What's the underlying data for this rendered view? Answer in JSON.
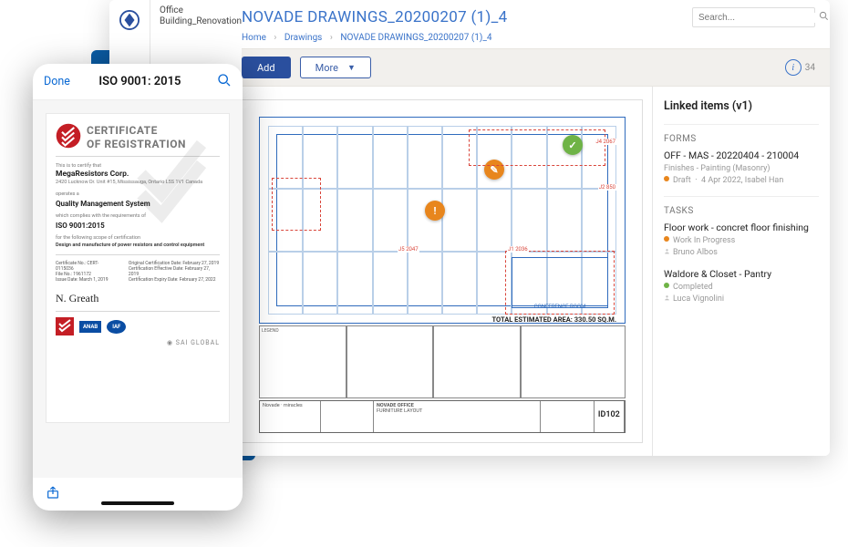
{
  "context_project": "Office Building_Renovation",
  "page_title": "NOVADE DRAWINGS_20200207 (1)_4",
  "search": {
    "placeholder": "Search..."
  },
  "breadcrumbs": {
    "home": "Home",
    "drawings": "Drawings",
    "current": "NOVADE DRAWINGS_20200207 (1)_4"
  },
  "toolbar": {
    "add": "Add",
    "more": "More",
    "info_count": "34"
  },
  "drawing": {
    "area_text": "TOTAL ESTIMATED AREA: 330.50 SQ.M.",
    "conf_room": "CONFERENCE ROOM",
    "sheet_id": "ID102",
    "owner": "NOVADE OFFICE",
    "brand": "Novade",
    "firm": "miracles",
    "schedule_title": "FURNITURE LAYOUT",
    "dim_j5": "J5",
    "dim_j5_val": "2047",
    "dim_j1": "J1",
    "dim_j1_val": "2036",
    "dim_j2": "J2",
    "dim_j2_val": "850",
    "dim_j4": "J4",
    "dim_j4_val": "2067"
  },
  "side_panel": {
    "title": "Linked items (v1)",
    "forms_label": "FORMS",
    "tasks_label": "TASKS",
    "form1": {
      "title": "OFF - MAS - 20220404 - 210004",
      "subtitle": "Finishes - Painting (Masonry)",
      "status": "Draft",
      "date": "4 Apr 2022",
      "assignee": "Isabel Han"
    },
    "task1": {
      "title": "Floor work - concret floor finishing",
      "status": "Work In Progress",
      "assignee": "Bruno Albos"
    },
    "task2": {
      "title": "Waldore & Closet - Pantry",
      "status": "Completed",
      "assignee": "Luca Vignolini"
    }
  },
  "mobile": {
    "done": "Done",
    "title": "ISO 9001: 2015",
    "cert": {
      "heading_l1": "CERTIFICATE",
      "heading_l2": "OF REGISTRATION",
      "intro": "This is to certify that",
      "company": "MegaResistors Corp.",
      "address": "2420 Lucknow Dr. Unit #15, Mississauga, Ontario L5S 1V1 Canada",
      "operates": "operates a",
      "qms": "Quality Management System",
      "complies": "which complies with the requirements of",
      "standard": "ISO 9001:2015",
      "scope_lead": "for the following scope of certification",
      "scope": "Design and manufacture of power resistors and control equipment",
      "cert_no_lbl": "Certificate No.:",
      "cert_no": "CERT-0115036",
      "file_no_lbl": "File No.:",
      "file_no": "1961172",
      "issue_lbl": "Issue Date:",
      "issue": "March 1, 2019",
      "orig_lbl": "Original Certification Date:",
      "orig": "February 27, 2019",
      "eff_lbl": "Certification Effective Date:",
      "eff": "February 27, 2019",
      "exp_lbl": "Certification Expiry Date:",
      "exp": "February 27, 2022",
      "sai": "SAI GLOBAL",
      "anab": "ANAB",
      "iaf": "IAF"
    }
  }
}
